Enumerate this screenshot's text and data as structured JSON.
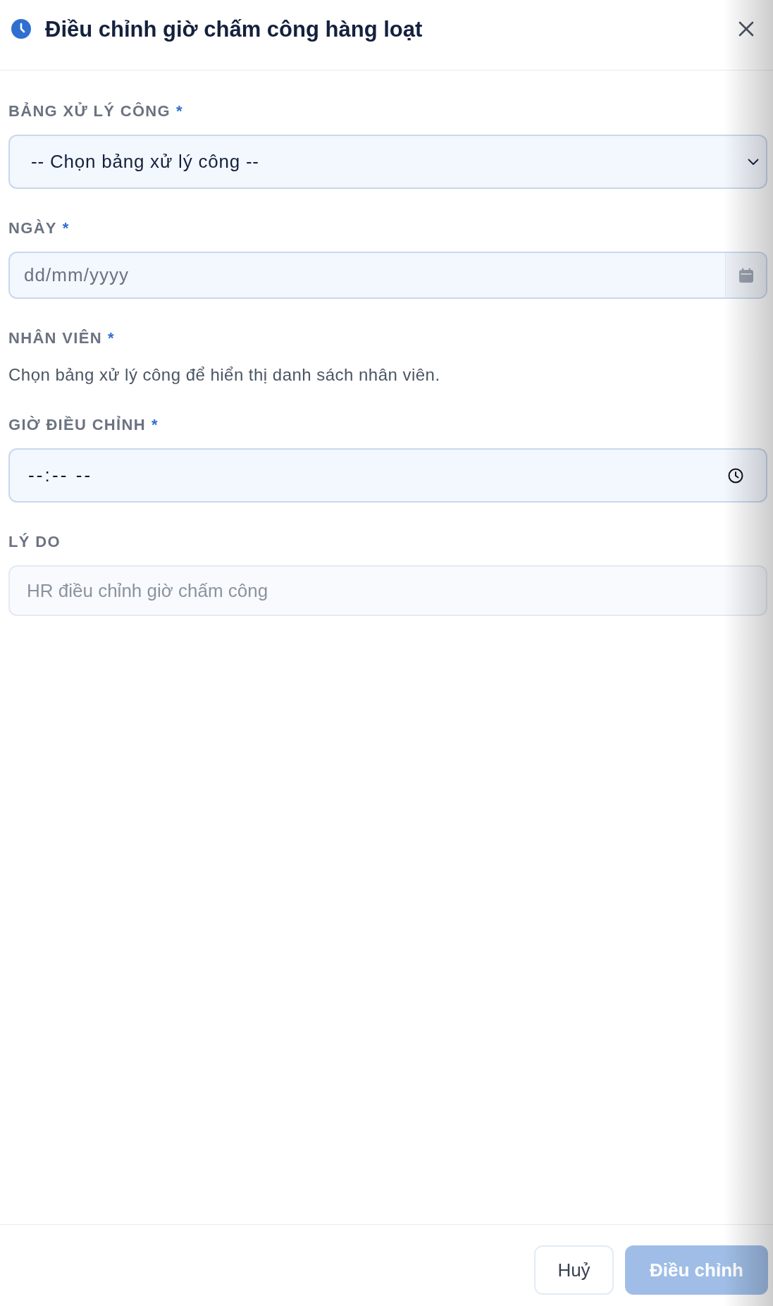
{
  "dialog": {
    "title": "Điều chỉnh giờ chấm công hàng loạt"
  },
  "fields": [
    {
      "kind": "select",
      "label": "BẢNG XỬ LÝ CÔNG",
      "required_mark": "*",
      "value": "-- Chọn bảng xử lý công --"
    },
    {
      "kind": "date",
      "label": "NGÀY",
      "required_mark": "*",
      "placeholder": "dd/mm/yyyy"
    },
    {
      "kind": "note",
      "label": "NHÂN VIÊN",
      "required_mark": "*",
      "note": "Chọn bảng xử lý công để hiển thị danh sách nhân viên."
    },
    {
      "kind": "time",
      "label": "GIỜ ĐIỀU CHỈNH",
      "required_mark": "*",
      "value": "--:-- --"
    },
    {
      "kind": "text",
      "label": "LÝ DO",
      "placeholder": "HR điều chỉnh giờ chấm công"
    }
  ],
  "footer": {
    "buttons": [
      {
        "kind": "secondary",
        "label": "Huỷ",
        "disabled": false
      },
      {
        "kind": "primary",
        "label": "Điều chỉnh",
        "disabled": true
      }
    ]
  }
}
